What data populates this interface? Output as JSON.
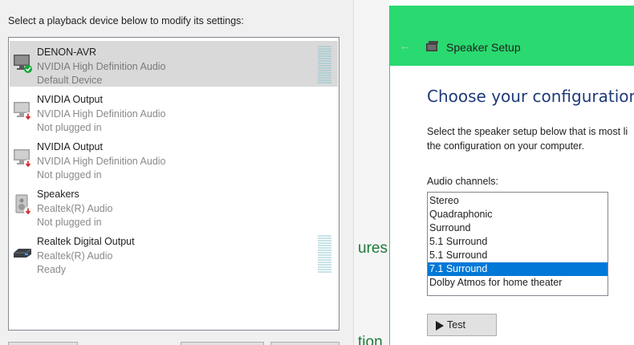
{
  "playback": {
    "instruction": "Select a playback device below to modify its settings:",
    "devices": [
      {
        "name": "DENON-AVR",
        "driver": "NVIDIA High Definition Audio",
        "status": "Default Device",
        "icon": "monitor-speaker-icon",
        "selected": true,
        "status_icon": "green-check-icon"
      },
      {
        "name": "NVIDIA Output",
        "driver": "NVIDIA High Definition Audio",
        "status": "Not plugged in",
        "icon": "monitor-speaker-icon",
        "selected": false,
        "status_icon": "red-down-arrow-icon"
      },
      {
        "name": "NVIDIA Output",
        "driver": "NVIDIA High Definition Audio",
        "status": "Not plugged in",
        "icon": "monitor-speaker-icon",
        "selected": false,
        "status_icon": "red-down-arrow-icon"
      },
      {
        "name": "Speakers",
        "driver": "Realtek(R) Audio",
        "status": "Not plugged in",
        "icon": "speaker-icon",
        "selected": false,
        "status_icon": "red-down-arrow-icon"
      },
      {
        "name": "Realtek Digital Output",
        "driver": "Realtek(R) Audio",
        "status": "Ready",
        "icon": "digital-output-icon",
        "selected": false,
        "status_icon": ""
      }
    ]
  },
  "background": {
    "frag1": "ures",
    "frag2": "tion"
  },
  "setup": {
    "back_icon": "back-arrow-icon",
    "title": "Speaker Setup",
    "heading": "Choose your configuration",
    "desc_line1": "Select the speaker setup below that is most li",
    "desc_line2": "the configuration on your computer.",
    "channels_label": "Audio channels:",
    "channels": [
      "Stereo",
      "Quadraphonic",
      "Surround",
      "5.1 Surround",
      "5.1 Surround",
      "7.1 Surround",
      "Dolby Atmos for home theater"
    ],
    "selected_channel": "7.1 Surround",
    "test_label": "Test"
  },
  "colors": {
    "accent_green": "#2ad970",
    "selection_blue": "#0078d7",
    "heading_blue": "#1f3a7a"
  }
}
